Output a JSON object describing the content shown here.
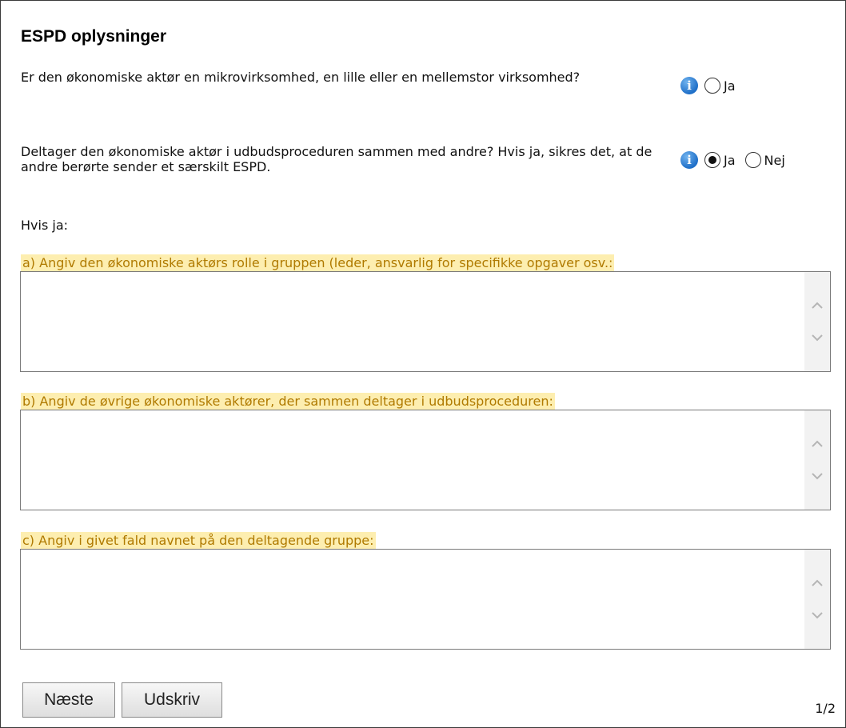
{
  "title": "ESPD oplysninger",
  "question1": {
    "text": "Er den økonomiske aktør en mikrovirksomhed, en lille eller en mellemstor virksomhed?",
    "info_icon": "info-icon",
    "options": [
      {
        "label": "Ja",
        "selected": false
      }
    ]
  },
  "question2": {
    "text": "Deltager den økonomiske aktør i udbudsproceduren sammen med andre? Hvis ja, sikres det, at de andre berørte sender et særskilt ESPD.",
    "info_icon": "info-icon",
    "options": [
      {
        "label": "Ja",
        "selected": true
      },
      {
        "label": "Nej",
        "selected": false
      }
    ]
  },
  "if_yes_label": "Hvis ja:",
  "fields": [
    {
      "label": "a) Angiv den økonomiske aktørs rolle i gruppen (leder, ansvarlig for specifikke opgaver osv.:",
      "value": ""
    },
    {
      "label": "b) Angiv de øvrige økonomiske aktører, der sammen deltager i udbudsproceduren:",
      "value": ""
    },
    {
      "label": "c) Angiv i givet fald navnet på den deltagende gruppe:",
      "value": ""
    }
  ],
  "buttons": {
    "next": "Næste",
    "print": "Udskriv"
  },
  "page_indicator": "1/2",
  "colors": {
    "highlight_bg": "#fdeeb0",
    "highlight_text": "#b07a00",
    "info_icon": "#1f6fc8"
  }
}
